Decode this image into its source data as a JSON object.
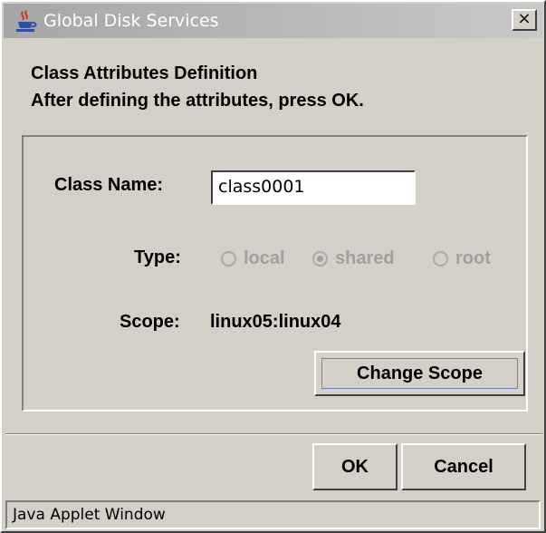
{
  "window": {
    "title": "Global Disk Services",
    "close_glyph": "×",
    "icon": "java-cup-icon"
  },
  "header": {
    "line1": "Class Attributes Definition",
    "line2": "After defining the attributes, press OK."
  },
  "form": {
    "class_name_label": "Class Name:",
    "class_name_value": "class0001",
    "type_label": "Type:",
    "type_options": [
      {
        "label": "local",
        "selected": false,
        "enabled": false
      },
      {
        "label": "shared",
        "selected": true,
        "enabled": false
      },
      {
        "label": "root",
        "selected": false,
        "enabled": false
      }
    ],
    "scope_label": "Scope:",
    "scope_value": "linux05:linux04",
    "change_scope_label": "Change Scope"
  },
  "buttons": {
    "ok_label": "OK",
    "cancel_label": "Cancel"
  },
  "status": {
    "text": "Java Applet Window"
  },
  "colors": {
    "titlebar": "#a6a6a6",
    "window_bg": "#d4d0c8",
    "disabled_text": "#a0a0a0"
  }
}
